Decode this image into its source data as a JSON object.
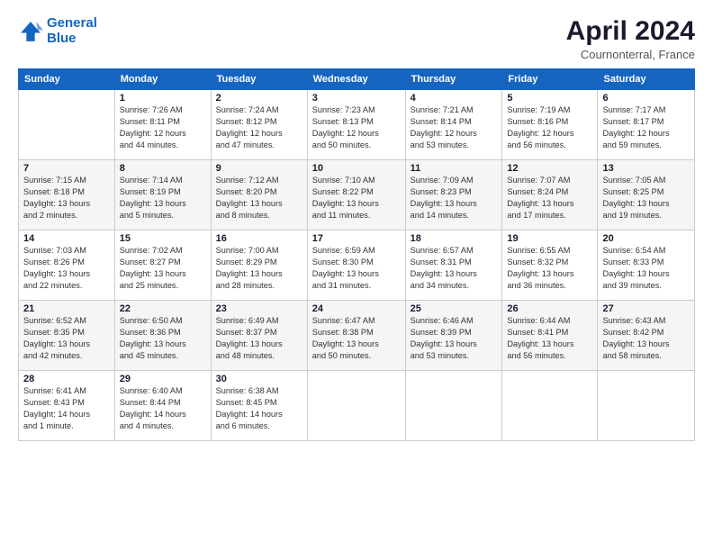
{
  "logo": {
    "line1": "General",
    "line2": "Blue"
  },
  "title": "April 2024",
  "subtitle": "Cournonterral, France",
  "days_header": [
    "Sunday",
    "Monday",
    "Tuesday",
    "Wednesday",
    "Thursday",
    "Friday",
    "Saturday"
  ],
  "weeks": [
    [
      {
        "day": "",
        "info": ""
      },
      {
        "day": "1",
        "info": "Sunrise: 7:26 AM\nSunset: 8:11 PM\nDaylight: 12 hours\nand 44 minutes."
      },
      {
        "day": "2",
        "info": "Sunrise: 7:24 AM\nSunset: 8:12 PM\nDaylight: 12 hours\nand 47 minutes."
      },
      {
        "day": "3",
        "info": "Sunrise: 7:23 AM\nSunset: 8:13 PM\nDaylight: 12 hours\nand 50 minutes."
      },
      {
        "day": "4",
        "info": "Sunrise: 7:21 AM\nSunset: 8:14 PM\nDaylight: 12 hours\nand 53 minutes."
      },
      {
        "day": "5",
        "info": "Sunrise: 7:19 AM\nSunset: 8:16 PM\nDaylight: 12 hours\nand 56 minutes."
      },
      {
        "day": "6",
        "info": "Sunrise: 7:17 AM\nSunset: 8:17 PM\nDaylight: 12 hours\nand 59 minutes."
      }
    ],
    [
      {
        "day": "7",
        "info": "Sunrise: 7:15 AM\nSunset: 8:18 PM\nDaylight: 13 hours\nand 2 minutes."
      },
      {
        "day": "8",
        "info": "Sunrise: 7:14 AM\nSunset: 8:19 PM\nDaylight: 13 hours\nand 5 minutes."
      },
      {
        "day": "9",
        "info": "Sunrise: 7:12 AM\nSunset: 8:20 PM\nDaylight: 13 hours\nand 8 minutes."
      },
      {
        "day": "10",
        "info": "Sunrise: 7:10 AM\nSunset: 8:22 PM\nDaylight: 13 hours\nand 11 minutes."
      },
      {
        "day": "11",
        "info": "Sunrise: 7:09 AM\nSunset: 8:23 PM\nDaylight: 13 hours\nand 14 minutes."
      },
      {
        "day": "12",
        "info": "Sunrise: 7:07 AM\nSunset: 8:24 PM\nDaylight: 13 hours\nand 17 minutes."
      },
      {
        "day": "13",
        "info": "Sunrise: 7:05 AM\nSunset: 8:25 PM\nDaylight: 13 hours\nand 19 minutes."
      }
    ],
    [
      {
        "day": "14",
        "info": "Sunrise: 7:03 AM\nSunset: 8:26 PM\nDaylight: 13 hours\nand 22 minutes."
      },
      {
        "day": "15",
        "info": "Sunrise: 7:02 AM\nSunset: 8:27 PM\nDaylight: 13 hours\nand 25 minutes."
      },
      {
        "day": "16",
        "info": "Sunrise: 7:00 AM\nSunset: 8:29 PM\nDaylight: 13 hours\nand 28 minutes."
      },
      {
        "day": "17",
        "info": "Sunrise: 6:59 AM\nSunset: 8:30 PM\nDaylight: 13 hours\nand 31 minutes."
      },
      {
        "day": "18",
        "info": "Sunrise: 6:57 AM\nSunset: 8:31 PM\nDaylight: 13 hours\nand 34 minutes."
      },
      {
        "day": "19",
        "info": "Sunrise: 6:55 AM\nSunset: 8:32 PM\nDaylight: 13 hours\nand 36 minutes."
      },
      {
        "day": "20",
        "info": "Sunrise: 6:54 AM\nSunset: 8:33 PM\nDaylight: 13 hours\nand 39 minutes."
      }
    ],
    [
      {
        "day": "21",
        "info": "Sunrise: 6:52 AM\nSunset: 8:35 PM\nDaylight: 13 hours\nand 42 minutes."
      },
      {
        "day": "22",
        "info": "Sunrise: 6:50 AM\nSunset: 8:36 PM\nDaylight: 13 hours\nand 45 minutes."
      },
      {
        "day": "23",
        "info": "Sunrise: 6:49 AM\nSunset: 8:37 PM\nDaylight: 13 hours\nand 48 minutes."
      },
      {
        "day": "24",
        "info": "Sunrise: 6:47 AM\nSunset: 8:38 PM\nDaylight: 13 hours\nand 50 minutes."
      },
      {
        "day": "25",
        "info": "Sunrise: 6:46 AM\nSunset: 8:39 PM\nDaylight: 13 hours\nand 53 minutes."
      },
      {
        "day": "26",
        "info": "Sunrise: 6:44 AM\nSunset: 8:41 PM\nDaylight: 13 hours\nand 56 minutes."
      },
      {
        "day": "27",
        "info": "Sunrise: 6:43 AM\nSunset: 8:42 PM\nDaylight: 13 hours\nand 58 minutes."
      }
    ],
    [
      {
        "day": "28",
        "info": "Sunrise: 6:41 AM\nSunset: 8:43 PM\nDaylight: 14 hours\nand 1 minute."
      },
      {
        "day": "29",
        "info": "Sunrise: 6:40 AM\nSunset: 8:44 PM\nDaylight: 14 hours\nand 4 minutes."
      },
      {
        "day": "30",
        "info": "Sunrise: 6:38 AM\nSunset: 8:45 PM\nDaylight: 14 hours\nand 6 minutes."
      },
      {
        "day": "",
        "info": ""
      },
      {
        "day": "",
        "info": ""
      },
      {
        "day": "",
        "info": ""
      },
      {
        "day": "",
        "info": ""
      }
    ]
  ]
}
